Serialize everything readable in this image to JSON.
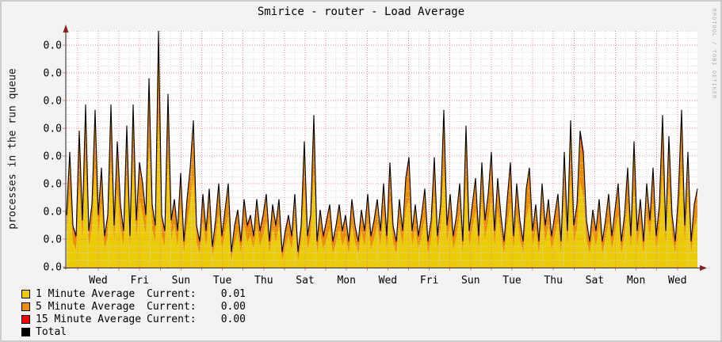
{
  "chart": {
    "title": "Smirice - router - Load Average",
    "y_axis_title": "processes in the run queue",
    "watermark": "RRDTOOL / TOBI OETIKER",
    "colors": {
      "background": "#f3f3f3",
      "canvas": "#ffffff",
      "minor_grid": "#d4d4d4",
      "major_grid": "#ee8888",
      "axis": "#2a2a2a",
      "arrow": "#8b1c1c",
      "one_min": "#EACC00",
      "five_min": "#EA8F00",
      "fifteen_min": "#FF0000",
      "total": "#000000"
    }
  },
  "legend_current_label": "Current:",
  "chart_data": {
    "type": "area",
    "stacked": true,
    "title": "Smirice - router - Load Average",
    "xlabel": "",
    "ylabel": "processes in the run queue",
    "ylim": [
      0,
      0.45
    ],
    "grid": true,
    "legend_position": "bottom-left",
    "y_tick_labels": [
      "0.0",
      "0.0",
      "0.0",
      "0.0",
      "0.0",
      "0.0",
      "0.0",
      "0.0",
      "0.0"
    ],
    "x_tick_labels": [
      "Wed",
      "Fri",
      "Sun",
      "Tue",
      "Thu",
      "Sat",
      "Mon",
      "Wed",
      "Fri",
      "Sun",
      "Tue",
      "Thu",
      "Sat",
      "Mon",
      "Wed"
    ],
    "x_tick_interval_days": 2,
    "series": [
      {
        "name": "1 Minute Average",
        "current": "0.01",
        "color": "#EACC00",
        "style": "area",
        "values": [
          0.061,
          0.141,
          0.048,
          0.034,
          0.16,
          0.054,
          0.202,
          0.041,
          0.074,
          0.187,
          0.061,
          0.121,
          0.034,
          0.061,
          0.202,
          0.048,
          0.147,
          0.074,
          0.041,
          0.175,
          0.034,
          0.202,
          0.054,
          0.128,
          0.101,
          0.061,
          0.231,
          0.074,
          0.048,
          0.291,
          0.061,
          0.041,
          0.213,
          0.054,
          0.081,
          0.041,
          0.115,
          0.027,
          0.081,
          0.121,
          0.174,
          0.048,
          0.027,
          0.088,
          0.041,
          0.094,
          0.021,
          0.054,
          0.101,
          0.034,
          0.068,
          0.101,
          0.012,
          0.048,
          0.068,
          0.027,
          0.081,
          0.048,
          0.061,
          0.034,
          0.081,
          0.041,
          0.061,
          0.088,
          0.027,
          0.074,
          0.048,
          0.081,
          0.012,
          0.041,
          0.061,
          0.034,
          0.088,
          0.012,
          0.048,
          0.147,
          0.034,
          0.061,
          0.18,
          0.027,
          0.068,
          0.034,
          0.054,
          0.074,
          0.027,
          0.048,
          0.074,
          0.041,
          0.061,
          0.027,
          0.081,
          0.048,
          0.027,
          0.068,
          0.041,
          0.088,
          0.034,
          0.054,
          0.081,
          0.041,
          0.101,
          0.034,
          0.122,
          0.048,
          0.027,
          0.081,
          0.041,
          0.108,
          0.129,
          0.041,
          0.074,
          0.034,
          0.061,
          0.094,
          0.027,
          0.054,
          0.135,
          0.034,
          0.074,
          0.187,
          0.048,
          0.088,
          0.034,
          0.061,
          0.101,
          0.027,
          0.167,
          0.041,
          0.074,
          0.108,
          0.034,
          0.128,
          0.054,
          0.088,
          0.135,
          0.041,
          0.108,
          0.061,
          0.027,
          0.081,
          0.122,
          0.034,
          0.101,
          0.054,
          0.027,
          0.094,
          0.121,
          0.041,
          0.074,
          0.027,
          0.101,
          0.048,
          0.081,
          0.034,
          0.061,
          0.088,
          0.027,
          0.135,
          0.041,
          0.174,
          0.048,
          0.074,
          0.16,
          0.137,
          0.054,
          0.027,
          0.068,
          0.041,
          0.081,
          0.027,
          0.054,
          0.088,
          0.034,
          0.068,
          0.101,
          0.027,
          0.061,
          0.121,
          0.034,
          0.149,
          0.041,
          0.081,
          0.027,
          0.101,
          0.054,
          0.121,
          0.034,
          0.074,
          0.18,
          0.041,
          0.155,
          0.061,
          0.027,
          0.088,
          0.187,
          0.048,
          0.137,
          0.027,
          0.074,
          0.094
        ]
      },
      {
        "name": "5 Minute Average",
        "current": "0.00",
        "color": "#EA8F00",
        "style": "stack",
        "values": [
          0.033,
          0.073,
          0.026,
          0.02,
          0.086,
          0.03,
          0.102,
          0.023,
          0.04,
          0.099,
          0.033,
          0.063,
          0.02,
          0.033,
          0.102,
          0.026,
          0.079,
          0.04,
          0.023,
          0.089,
          0.02,
          0.102,
          0.03,
          0.066,
          0.053,
          0.033,
          0.119,
          0.04,
          0.026,
          0.149,
          0.033,
          0.023,
          0.109,
          0.03,
          0.043,
          0.023,
          0.059,
          0.017,
          0.043,
          0.063,
          0.092,
          0.026,
          0.017,
          0.046,
          0.023,
          0.05,
          0.013,
          0.03,
          0.053,
          0.02,
          0.036,
          0.053,
          0.012,
          0.026,
          0.036,
          0.017,
          0.043,
          0.026,
          0.033,
          0.02,
          0.043,
          0.023,
          0.033,
          0.046,
          0.017,
          0.04,
          0.026,
          0.043,
          0.012,
          0.023,
          0.033,
          0.02,
          0.046,
          0.012,
          0.026,
          0.079,
          0.02,
          0.033,
          0.096,
          0.017,
          0.036,
          0.02,
          0.03,
          0.04,
          0.017,
          0.026,
          0.04,
          0.023,
          0.033,
          0.017,
          0.043,
          0.026,
          0.017,
          0.036,
          0.023,
          0.046,
          0.02,
          0.03,
          0.043,
          0.023,
          0.053,
          0.02,
          0.066,
          0.026,
          0.017,
          0.043,
          0.023,
          0.056,
          0.069,
          0.023,
          0.04,
          0.02,
          0.033,
          0.05,
          0.017,
          0.03,
          0.069,
          0.02,
          0.04,
          0.099,
          0.026,
          0.046,
          0.02,
          0.033,
          0.053,
          0.017,
          0.089,
          0.023,
          0.04,
          0.056,
          0.02,
          0.066,
          0.03,
          0.046,
          0.073,
          0.023,
          0.056,
          0.033,
          0.017,
          0.043,
          0.066,
          0.02,
          0.053,
          0.03,
          0.017,
          0.05,
          0.063,
          0.023,
          0.04,
          0.017,
          0.053,
          0.026,
          0.043,
          0.02,
          0.033,
          0.046,
          0.017,
          0.073,
          0.023,
          0.092,
          0.026,
          0.04,
          0.086,
          0.073,
          0.03,
          0.017,
          0.036,
          0.023,
          0.043,
          0.017,
          0.03,
          0.046,
          0.02,
          0.036,
          0.053,
          0.017,
          0.033,
          0.063,
          0.02,
          0.079,
          0.023,
          0.043,
          0.017,
          0.053,
          0.03,
          0.063,
          0.02,
          0.04,
          0.096,
          0.023,
          0.083,
          0.033,
          0.017,
          0.046,
          0.099,
          0.026,
          0.073,
          0.017,
          0.04,
          0.05
        ]
      },
      {
        "name": "15 Minute Average",
        "current": "0.00",
        "color": "#FF0000",
        "style": "stack",
        "values": [
          0.006,
          0.006,
          0.006,
          0.006,
          0.014,
          0.006,
          0.006,
          0.006,
          0.006,
          0.014,
          0.006,
          0.006,
          0.006,
          0.006,
          0.006,
          0.006,
          0.014,
          0.006,
          0.006,
          0.006,
          0.006,
          0.006,
          0.006,
          0.006,
          0.006,
          0.006,
          0.01,
          0.006,
          0.006,
          0.01,
          0.006,
          0.006,
          0.008,
          0.006,
          0.006,
          0.006,
          0.006,
          0.006,
          0.006,
          0.006,
          0.014,
          0.006,
          0.006,
          0.006,
          0.006,
          0.006,
          0.006,
          0.006,
          0.006,
          0.006,
          0.006,
          0.006,
          0.006,
          0.006,
          0.006,
          0.006,
          0.006,
          0.006,
          0.006,
          0.006,
          0.006,
          0.006,
          0.006,
          0.006,
          0.006,
          0.006,
          0.006,
          0.006,
          0.006,
          0.006,
          0.006,
          0.006,
          0.006,
          0.006,
          0.006,
          0.014,
          0.006,
          0.006,
          0.014,
          0.006,
          0.006,
          0.006,
          0.006,
          0.006,
          0.006,
          0.006,
          0.006,
          0.006,
          0.006,
          0.006,
          0.006,
          0.006,
          0.006,
          0.006,
          0.006,
          0.006,
          0.006,
          0.006,
          0.006,
          0.006,
          0.006,
          0.006,
          0.012,
          0.006,
          0.006,
          0.006,
          0.006,
          0.006,
          0.012,
          0.006,
          0.006,
          0.006,
          0.006,
          0.006,
          0.006,
          0.006,
          0.006,
          0.006,
          0.006,
          0.014,
          0.006,
          0.006,
          0.006,
          0.006,
          0.006,
          0.006,
          0.014,
          0.006,
          0.006,
          0.006,
          0.006,
          0.006,
          0.006,
          0.006,
          0.012,
          0.006,
          0.006,
          0.006,
          0.006,
          0.006,
          0.012,
          0.006,
          0.006,
          0.006,
          0.006,
          0.006,
          0.006,
          0.006,
          0.006,
          0.006,
          0.006,
          0.006,
          0.006,
          0.006,
          0.006,
          0.006,
          0.006,
          0.012,
          0.006,
          0.014,
          0.006,
          0.006,
          0.014,
          0.01,
          0.006,
          0.006,
          0.006,
          0.006,
          0.006,
          0.006,
          0.006,
          0.006,
          0.006,
          0.006,
          0.006,
          0.006,
          0.006,
          0.006,
          0.006,
          0.012,
          0.006,
          0.006,
          0.006,
          0.006,
          0.006,
          0.006,
          0.006,
          0.006,
          0.014,
          0.006,
          0.012,
          0.006,
          0.006,
          0.006,
          0.014,
          0.006,
          0.01,
          0.006,
          0.006,
          0.006
        ]
      },
      {
        "name": "Total",
        "current": null,
        "color": "#000000",
        "style": "line",
        "derived": "sum of stacked series"
      }
    ]
  }
}
